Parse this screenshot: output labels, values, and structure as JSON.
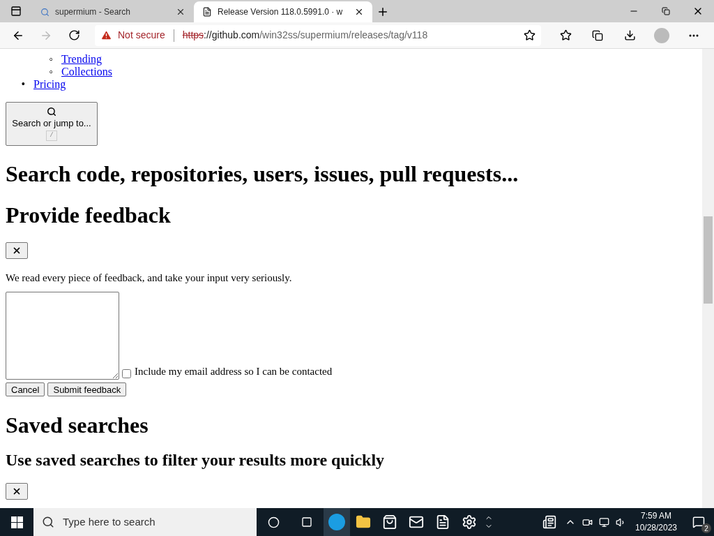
{
  "browser": {
    "tabs": [
      {
        "title": "supermium - Search",
        "kind": "search",
        "selected": false
      },
      {
        "title": "Release Version 118.0.5991.0 · w",
        "kind": "page",
        "selected": true
      }
    ],
    "security": "Not secure",
    "url_scheme": "https",
    "url_host": "://github.com",
    "url_path": "/win32ss/supermium/releases/tag/v118"
  },
  "page": {
    "sub_links": [
      {
        "marker": "◦",
        "text": "Trending"
      },
      {
        "marker": "◦",
        "text": "Collections"
      }
    ],
    "links": [
      {
        "marker": "•",
        "text": "Pricing"
      }
    ],
    "search_button": "Search or jump to...",
    "search_key": "/",
    "heading_search": "Search code, repositories, users, issues, pull requests...",
    "heading_feedback": "Provide feedback",
    "feedback_text": "We read every piece of feedback, and take your input very seriously.",
    "email_checkbox": {
      "label": "Include my email address so I can be contacted",
      "checked": false
    },
    "buttons": [
      "Cancel",
      "Submit feedback"
    ],
    "heading_saved": "Saved searches",
    "subheading_saved": "Use saved searches to filter your results more quickly"
  },
  "taskbar": {
    "search_placeholder": "Type here to search",
    "time": "7:59 AM",
    "date": "10/28/2023",
    "notifications": "2"
  }
}
